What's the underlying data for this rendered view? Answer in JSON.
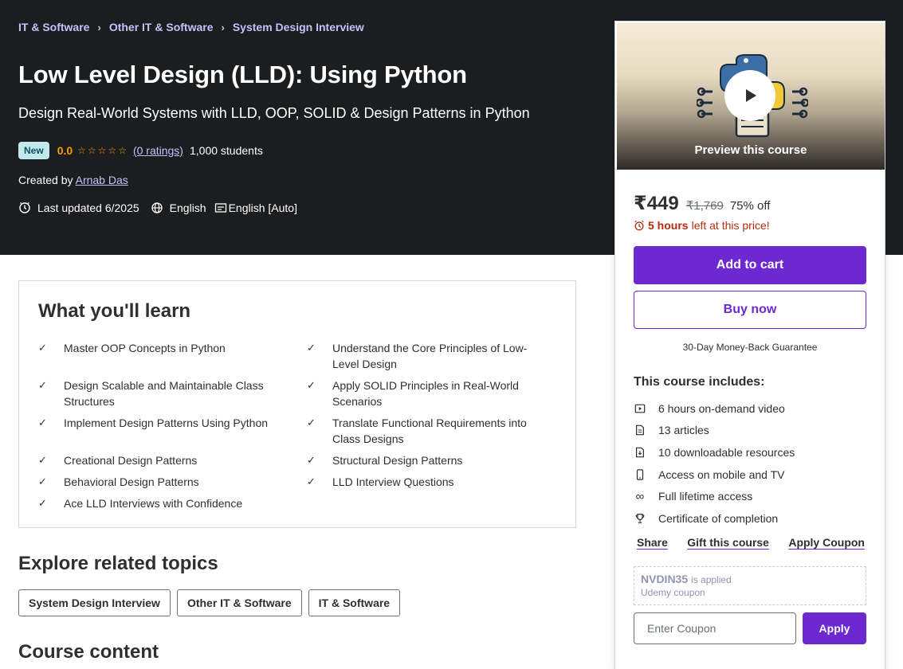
{
  "breadcrumb": {
    "items": [
      "IT & Software",
      "Other IT & Software",
      "System Design Interview"
    ]
  },
  "course": {
    "title": "Low Level Design (LLD): Using Python",
    "subtitle": "Design Real-World Systems with LLD, OOP, SOLID & Design Patterns in Python",
    "badge": "New",
    "rating": "0.0",
    "rating_stars": 0,
    "ratings_link": "(0 ratings)",
    "students": "1,000 students",
    "created_by_label": "Created by",
    "author": "Arnab Das",
    "last_updated": "Last updated 6/2025",
    "language": "English",
    "captions": "English [Auto]"
  },
  "card": {
    "preview_label": "Preview this course",
    "price": "₹449",
    "original_price": "₹1,769",
    "discount": "75% off",
    "timer_hours": "5 hours",
    "timer_text": "left at this price!",
    "add_to_cart": "Add to cart",
    "buy_now": "Buy now",
    "guarantee": "30-Day Money-Back Guarantee",
    "includes_title": "This course includes:",
    "includes": [
      {
        "icon": "video-icon",
        "label": "6 hours on-demand video"
      },
      {
        "icon": "article-icon",
        "label": "13 articles"
      },
      {
        "icon": "download-icon",
        "label": "10 downloadable resources"
      },
      {
        "icon": "mobile-icon",
        "label": "Access on mobile and TV"
      },
      {
        "icon": "infinity-icon",
        "label": "Full lifetime access"
      },
      {
        "icon": "trophy-icon",
        "label": "Certificate of completion"
      }
    ],
    "links": {
      "share": "Share",
      "gift": "Gift this course",
      "coupon": "Apply Coupon"
    },
    "coupon": {
      "code": "NVDIN35",
      "applied": "is applied",
      "source": "Udemy coupon"
    },
    "coupon_placeholder": "Enter Coupon",
    "apply": "Apply"
  },
  "learn": {
    "title": "What you'll learn",
    "items": [
      "Master OOP Concepts in Python",
      "Understand the Core Principles of Low-Level Design",
      "Design Scalable and Maintainable Class Structures",
      "Apply SOLID Principles in Real-World Scenarios",
      "Implement Design Patterns Using Python",
      "Translate Functional Requirements into Class Designs",
      "Creational Design Patterns",
      "Structural Design Patterns",
      "Behavioral Design Patterns",
      "LLD Interview Questions",
      "Ace LLD Interviews with Confidence"
    ]
  },
  "related": {
    "title": "Explore related topics",
    "topics": [
      "System Design Interview",
      "Other IT & Software",
      "IT & Software"
    ]
  },
  "content": {
    "title": "Course content"
  },
  "colors": {
    "hero_bg": "#1c1d1f",
    "accent": "#6d28d2",
    "link": "#c0c4fc",
    "star": "#f69c08",
    "timer": "#b32d0f"
  }
}
